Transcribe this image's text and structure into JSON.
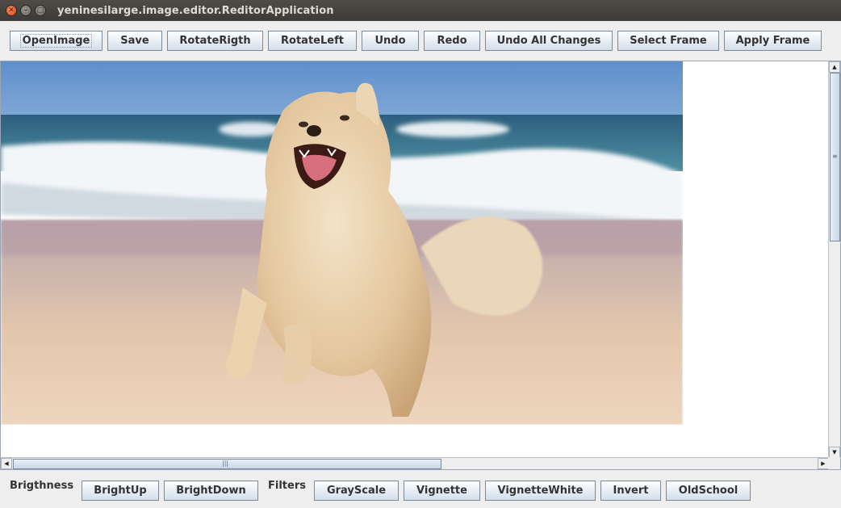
{
  "window": {
    "title": "yeninesilarge.image.editor.ReditorApplication",
    "controls": {
      "close": "✕",
      "minimize": "–",
      "maximize": "□"
    }
  },
  "toolbar": {
    "open_image": "OpenImage",
    "save": "Save",
    "rotate_right": "RotateRigth",
    "rotate_left": "RotateLeft",
    "undo": "Undo",
    "redo": "Redo",
    "undo_all": "Undo All Changes",
    "select_frame": "Select Frame",
    "apply_frame": "Apply Frame"
  },
  "bottom_bar": {
    "brightness_label": "Brigthness",
    "bright_up": "BrightUp",
    "bright_down": "BrightDown",
    "filters_label": "Filters",
    "grayscale": "GrayScale",
    "vignette": "Vignette",
    "vignette_white": "VignetteWhite",
    "invert": "Invert",
    "oldschool": "OldSchool"
  },
  "image": {
    "subject": "golden retriever running on a beach",
    "colors": {
      "sky": "#5b8fc9",
      "sea": "#3f7e96",
      "foam": "#f2f5f7",
      "sand": "#e8cdb0",
      "dog": "#e9d2b0"
    }
  },
  "icons": {
    "scroll_up": "▲",
    "scroll_down": "▼",
    "scroll_left": "◀",
    "scroll_right": "▶",
    "grip_v": "≡",
    "grip_h": "|||"
  }
}
